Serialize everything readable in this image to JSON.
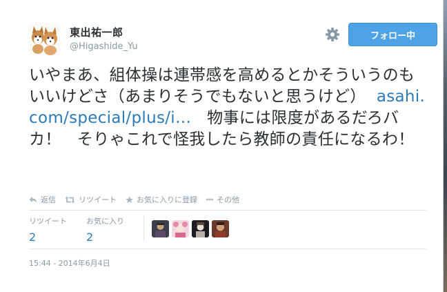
{
  "user": {
    "display_name": "東出祐一郎",
    "handle": "@Higashide_Yu"
  },
  "follow_button": {
    "label": "フォロー中"
  },
  "tweet": {
    "text_before": "いやまあ、組体操は連帯感を高めるとかそういうのもいいけどさ（あまりそうでもないと思うけど）",
    "link_text": "asahi.com/special/plus/i…",
    "text_after": "物事には限度があるだろバカ！　そりゃこれで怪我したら教師の責任になるわ！"
  },
  "actions": [
    {
      "label": "返信",
      "icon": "reply-icon"
    },
    {
      "label": "リツイート",
      "icon": "retweet-icon"
    },
    {
      "label": "お気に入りに登録",
      "icon": "star-icon"
    },
    {
      "label": "その他",
      "icon": "more-icon"
    }
  ],
  "stats": {
    "retweets": {
      "label": "リツイート",
      "count": "2"
    },
    "favorites": {
      "label": "お気に入り",
      "count": "2"
    }
  },
  "favoriters": [
    "user-avatar-1",
    "user-avatar-2",
    "user-avatar-3",
    "user-avatar-4"
  ],
  "timestamp": "15:44 - 2014年6月4日",
  "colors": {
    "link": "#2b7bb9",
    "follow_button": "#4ea3e6",
    "muted": "#8899a6",
    "text": "#292f33"
  }
}
